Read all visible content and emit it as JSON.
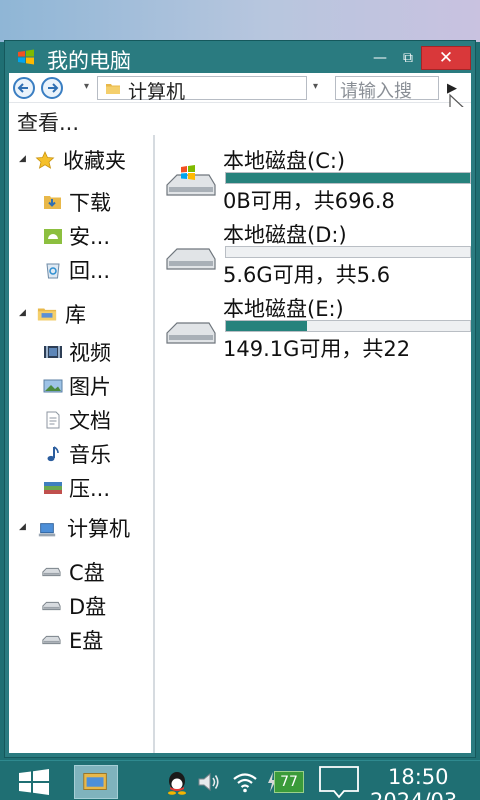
{
  "window": {
    "title": "我的电脑",
    "minimize_label": "—",
    "maximize_label": "⧉",
    "close_label": "✕"
  },
  "address": {
    "path": "计算机",
    "search_placeholder": "请输入搜",
    "go_label": "▶"
  },
  "toolbar": {
    "view_label": "查看..."
  },
  "sidebar": {
    "favorites": {
      "label": "收藏夹",
      "icon": "star-icon"
    },
    "favorite_items": [
      {
        "label": "下载",
        "icon": "download-folder-icon"
      },
      {
        "label": "安...",
        "icon": "android-icon"
      },
      {
        "label": "回...",
        "icon": "recycle-bin-icon"
      }
    ],
    "library": {
      "label": "库",
      "icon": "library-folder-icon"
    },
    "library_items": [
      {
        "label": "视频",
        "icon": "video-icon"
      },
      {
        "label": "图片",
        "icon": "picture-icon"
      },
      {
        "label": "文档",
        "icon": "document-icon"
      },
      {
        "label": "音乐",
        "icon": "music-icon"
      },
      {
        "label": "压...",
        "icon": "archive-icon"
      }
    ],
    "computer": {
      "label": "计算机",
      "icon": "computer-icon"
    },
    "computer_items": [
      {
        "label": "C盘",
        "icon": "drive-icon"
      },
      {
        "label": "D盘",
        "icon": "drive-icon"
      },
      {
        "label": "E盘",
        "icon": "drive-icon"
      }
    ]
  },
  "drives": [
    {
      "name": "本地磁盘(C:)",
      "free": "0B可用，共696.8",
      "used_fraction": 1.0,
      "system": true
    },
    {
      "name": "本地磁盘(D:)",
      "free": "5.6G可用，共5.6",
      "used_fraction": 0.0,
      "system": false
    },
    {
      "name": "本地磁盘(E:)",
      "free": "149.1G可用，共22",
      "used_fraction": 0.33,
      "system": false
    }
  ],
  "taskbar": {
    "time": "18:50",
    "date": "2024/03",
    "battery": "77"
  },
  "colors": {
    "accent": "#26827c",
    "close": "#d9383a",
    "taskbar": "#1f6f73"
  }
}
